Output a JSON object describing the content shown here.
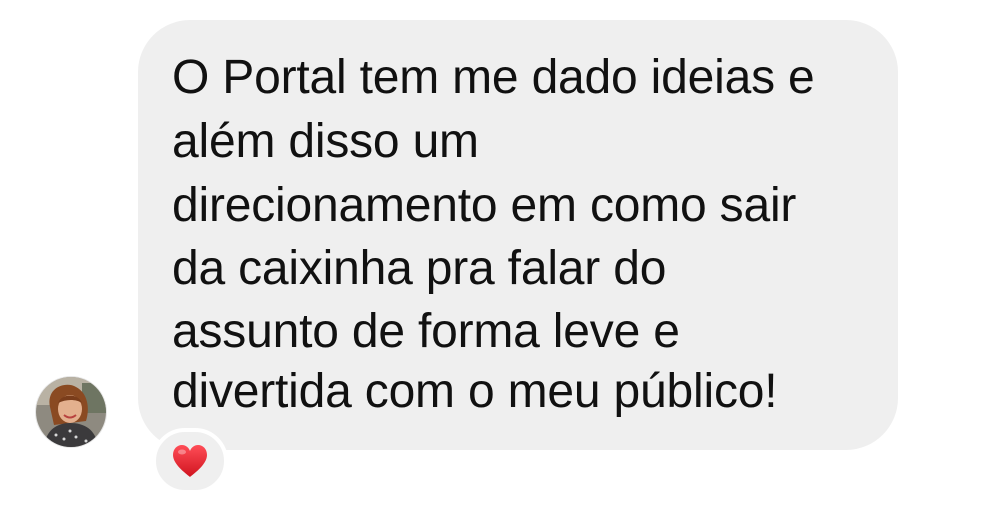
{
  "message": {
    "lines": [
      "O Portal tem me dado ideias e",
      "além disso um",
      "direcionamento em como sair",
      "da caixinha pra falar do",
      "assunto de forma leve e",
      "divertida com o meu público!"
    ]
  },
  "reaction": {
    "icon": "heart-icon",
    "color": "#e0242f"
  },
  "colors": {
    "bubble": "#efefef",
    "text": "#111111"
  }
}
